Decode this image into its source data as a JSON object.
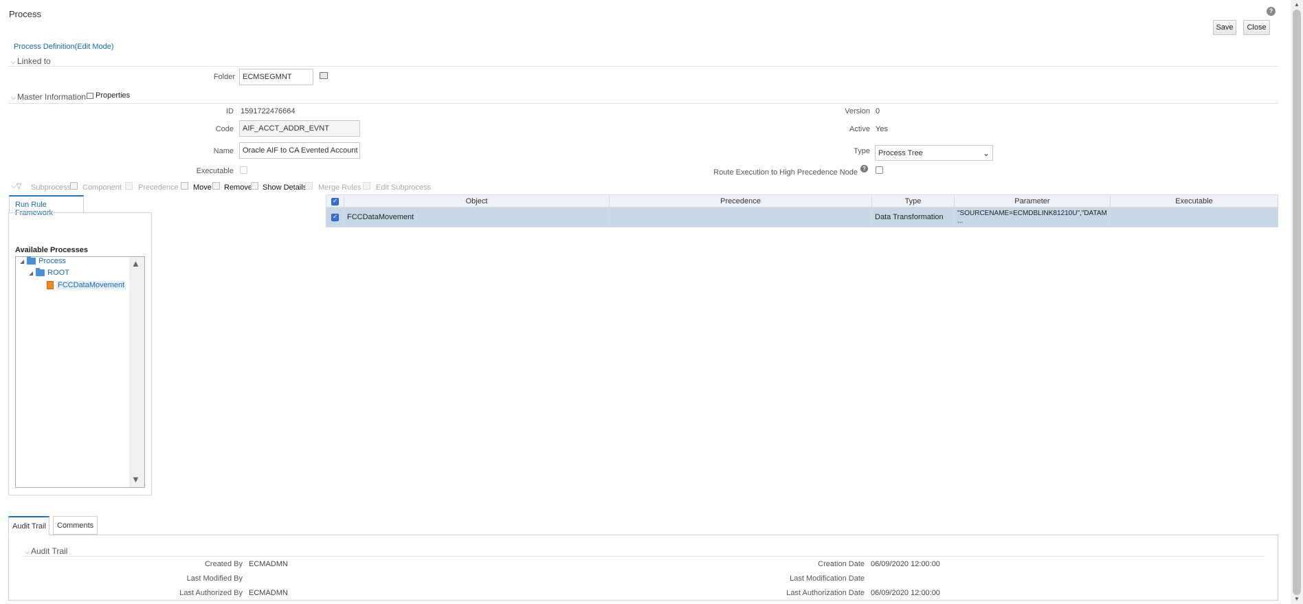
{
  "window": {
    "title": "Process"
  },
  "buttons": {
    "save": "Save",
    "close": "Close"
  },
  "breadcrumb": "Process Definition(Edit Mode)",
  "linked_to": {
    "title": "Linked to",
    "folder_label": "Folder",
    "folder_value": "ECMSEGMNT"
  },
  "master": {
    "title": "Master Information",
    "properties": "Properties",
    "id_label": "ID",
    "id_value": "1591722476664",
    "code_label": "Code",
    "code_value": "AIF_ACCT_ADDR_EVNT",
    "name_label": "Name",
    "name_value": "Oracle AIF to CA Evented Account Add",
    "executable_label": "Executable",
    "version_label": "Version",
    "version_value": "0",
    "active_label": "Active",
    "active_value": "Yes",
    "type_label": "Type",
    "type_value": "Process Tree",
    "route_label": "Route Execution to High Precedence Node"
  },
  "toolbar": {
    "subprocess": "Subprocess",
    "component": "Component",
    "precedence": "Precedence",
    "move": "Move",
    "remove": "Remove",
    "show_details": "Show Details",
    "merge_rules": "Merge Rules",
    "edit_subprocess": "Edit Subprocess"
  },
  "left_panel": {
    "tab": "Run Rule Framework",
    "available_title": "Available Processes",
    "tree": {
      "root": "Process",
      "child": "ROOT",
      "leaf": "FCCDataMovement"
    }
  },
  "grid": {
    "columns": [
      "Object",
      "Precedence",
      "Type",
      "Parameter",
      "Executable"
    ],
    "rows": [
      {
        "object": "FCCDataMovement",
        "precedence": "",
        "type": "Data Transformation",
        "parameter_line1": "\"SOURCENAME=ECMDBLINK81210U\",\"DATAM",
        "parameter_line2": "...",
        "executable": ""
      }
    ]
  },
  "bottom_tabs": {
    "audit": "Audit Trail",
    "comments": "Comments"
  },
  "audit": {
    "title": "Audit Trail",
    "created_by_label": "Created By",
    "created_by_value": "ECMADMN",
    "last_modified_by_label": "Last Modified By",
    "last_modified_by_value": "",
    "last_authorized_by_label": "Last Authorized By",
    "last_authorized_by_value": "ECMADMN",
    "creation_date_label": "Creation Date",
    "creation_date_value": "06/09/2020 12:00:00",
    "last_modification_date_label": "Last Modification Date",
    "last_modification_date_value": "",
    "last_authorization_date_label": "Last Authorization Date",
    "last_authorization_date_value": "06/09/2020 12:00:00"
  },
  "colors": {
    "link": "#1a6bb0",
    "row_selected": "#c6d8e6",
    "header": "#eef2f8"
  }
}
